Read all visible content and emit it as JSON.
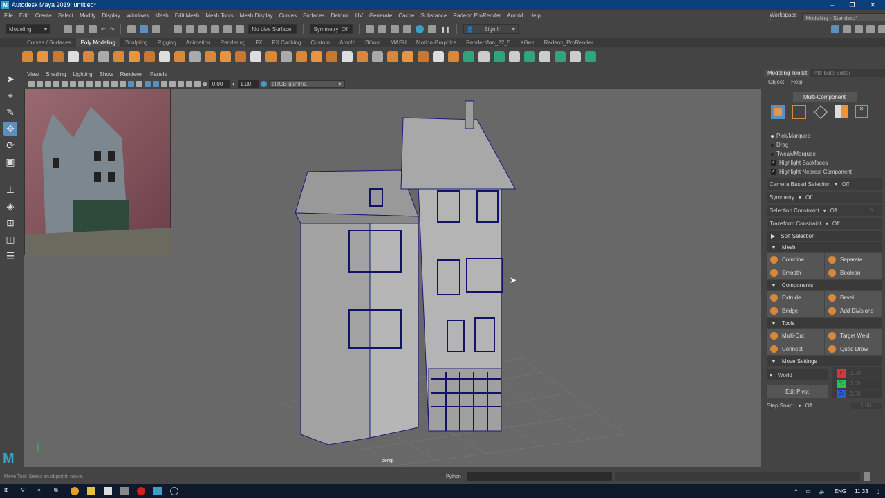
{
  "app": {
    "title": "Autodesk Maya 2019: untitled*",
    "window_controls": [
      "–",
      "❐",
      "✕"
    ]
  },
  "menu": [
    "File",
    "Edit",
    "Create",
    "Select",
    "Modify",
    "Display",
    "Windows",
    "Mesh",
    "Edit Mesh",
    "Mesh Tools",
    "Mesh Display",
    "Curves",
    "Surfaces",
    "Deform",
    "UV",
    "Generate",
    "Cache",
    "Substance",
    "Radeon ProRender",
    "Arnold",
    "Help"
  ],
  "workspace": {
    "label": "Workspace :",
    "value": "Modeling - Standard*"
  },
  "statusline": {
    "mode": "Modeling",
    "live_surface": "No Live Surface",
    "symmetry": "Symmetry: Off",
    "sign_in": "Sign In"
  },
  "shelf_tabs": [
    "Curves / Surfaces",
    "Poly Modeling",
    "Sculpting",
    "Rigging",
    "Animation",
    "Rendering",
    "FX",
    "FX Caching",
    "Custom",
    "Arnold",
    "Bifrost",
    "MASH",
    "Motion Graphics",
    "RenderMan_22_5",
    "XGen",
    "Radeon_ProRender"
  ],
  "shelf_active": "Poly Modeling",
  "viewport": {
    "menu": [
      "View",
      "Shading",
      "Lighting",
      "Show",
      "Renderer",
      "Panels"
    ],
    "exposure": "0.00",
    "gamma": "1.00",
    "color_space": "sRGB gamma",
    "camera": "persp"
  },
  "panel": {
    "tabs": [
      "Modeling Toolkit",
      "Attribute Editor"
    ],
    "menu": [
      "Object",
      "Help"
    ],
    "mode": "Multi-Component",
    "pick_modes": [
      "Pick/Marquee",
      "Drag",
      "Tweak/Marquee"
    ],
    "checks": [
      "Highlight Backfaces",
      "Highlight Nearest Component"
    ],
    "options": [
      {
        "label": "Camera Based Selection",
        "value": "Off"
      },
      {
        "label": "Symmetry",
        "value": "Off"
      },
      {
        "label": "Selection Constraint",
        "value": "Off",
        "extra": "0"
      },
      {
        "label": "Transform Constraint",
        "value": "Off"
      }
    ],
    "soft_selection": "Soft Selection",
    "sections": [
      {
        "title": "Mesh",
        "buttons": [
          "Combine",
          "Separate",
          "Smooth",
          "Boolean"
        ]
      },
      {
        "title": "Components",
        "buttons": [
          "Extrude",
          "Bevel",
          "Bridge",
          "Add Divisions"
        ]
      },
      {
        "title": "Tools",
        "buttons": [
          "Multi-Cut",
          "Target Weld",
          "Connect",
          "Quad Draw"
        ]
      }
    ],
    "move_settings": {
      "title": "Move Settings",
      "space": "World",
      "edit_pivot": "Edit Pivot",
      "axes": [
        {
          "label": "X:",
          "value": "0.00",
          "color": "#d23a3a"
        },
        {
          "label": "Y:",
          "value": "0.00",
          "color": "#2fbf5a"
        },
        {
          "label": "Z:",
          "value": "0.00",
          "color": "#2a5bd8"
        }
      ],
      "step_snap_label": "Step Snap:",
      "step_snap": "Off",
      "step_value": "1.00"
    }
  },
  "helpline": {
    "text": "Move Tool: Select an object to move.",
    "python": "Python"
  },
  "taskbar": {
    "lang": "ENG",
    "time": "11:33"
  }
}
